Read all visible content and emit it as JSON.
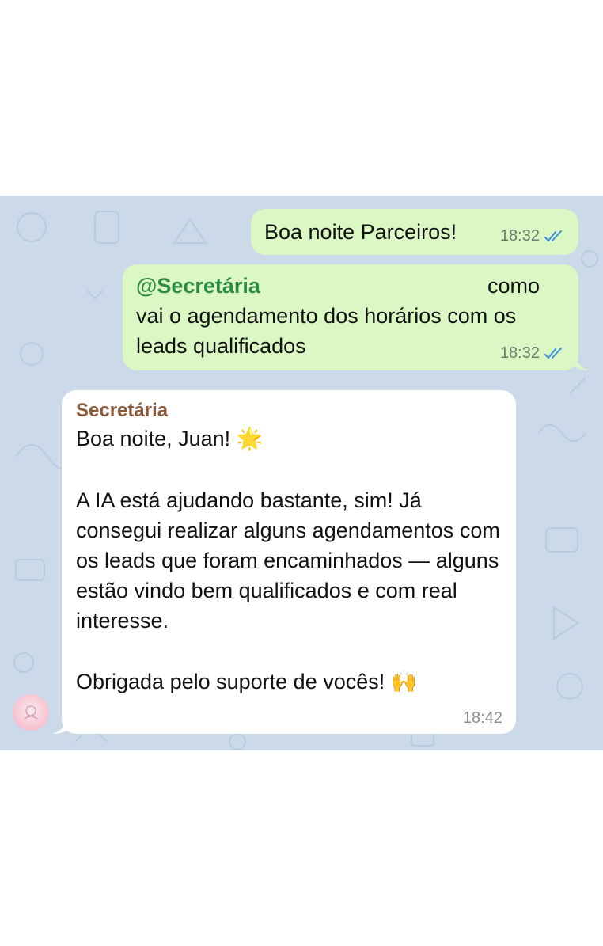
{
  "colors": {
    "chat_background": "#ccd9e9",
    "outgoing_bubble": "#dbf7c4",
    "incoming_bubble": "#ffffff",
    "mention": "#2e8b43",
    "sender_name": "#8b5a3c",
    "read_ticks": "#3c8fe2"
  },
  "messages": [
    {
      "direction": "outgoing",
      "text": "Boa noite Parceiros!",
      "time": "18:32",
      "status_icon": "double-check-icon"
    },
    {
      "direction": "outgoing",
      "mention": "@Secretária",
      "text_line1_end": "como",
      "text_rest": "vai o agendamento dos horários com os leads qualificados",
      "time": "18:32",
      "status_icon": "double-check-icon"
    },
    {
      "direction": "incoming",
      "sender": "Secretária",
      "greeting": "Boa noite, Juan!",
      "greeting_emoji": "🌟",
      "paragraph": "A IA está ajudando bastante, sim! Já consegui realizar alguns agendamentos com os leads que foram encaminhados — alguns estão vindo bem qualificados e com real interesse.",
      "closing": "Obrigada pelo suporte de vocês!",
      "closing_emoji": "🙌",
      "time": "18:42"
    }
  ],
  "avatar": {
    "icon": "profile-avatar-icon"
  }
}
